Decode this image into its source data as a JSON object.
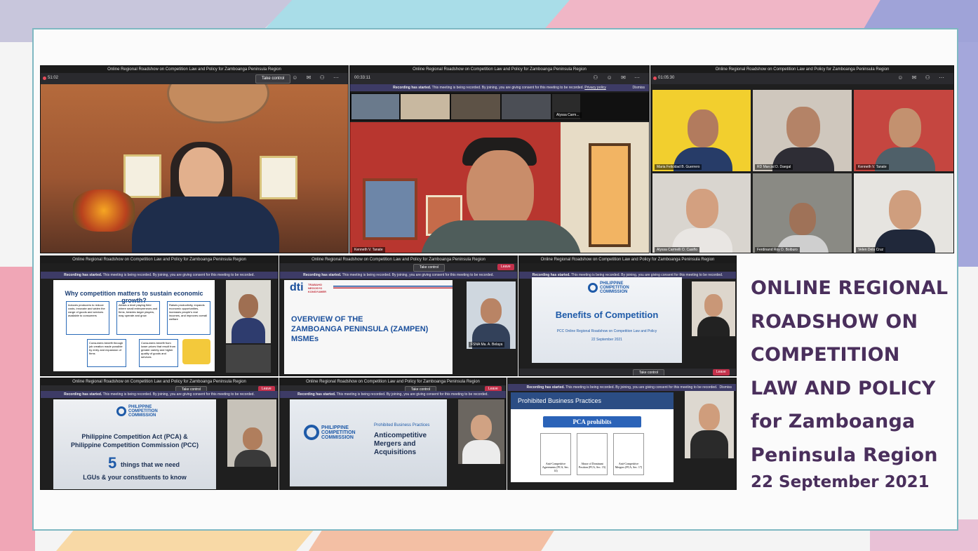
{
  "banner": {
    "title_lines": [
      "ONLINE REGIONAL",
      "ROADSHOW ON",
      "COMPETITION",
      "LAW AND POLICY",
      "for Zamboanga",
      "Peninsula Region"
    ],
    "date": "22 September 2021"
  },
  "meeting_title": "Online Regional Roadshow on Competition Law and Policy for Zamboanga Peninsula Region",
  "recording_notice": "Recording has started.",
  "recording_detail": "This meeting is being recorded. By joining, you are giving consent for this meeting to be recorded.",
  "privacy_policy": "Privacy policy",
  "dismiss": "Dismiss",
  "take_control": "Take control",
  "leave": "Leave",
  "windows": {
    "w1": {
      "timer": "51:02"
    },
    "w2": {
      "timer": "00:33:11",
      "main_name": "Kenneth V. Tanate",
      "thumb_name": "Alyssa Carm..."
    },
    "w3": {
      "timer": "01:05:30",
      "names": [
        "Maria Felicidad B. Guerrero",
        "RD Marcial D. Daegal",
        "Kenneth V. Tanate",
        "Alyssa Carmelli O. Casiño",
        "Ferdinand Roy D. Boiburo",
        "Velen Dela Cruz"
      ]
    }
  },
  "slides": {
    "s1": {
      "title": "Why competition matters to sustain economic growth?",
      "boxes": [
        "Induces producers to reduce costs, innovate and widen the range of goods and services available to consumers",
        "Allows a level playing field where small entrepreneurs and firms, besides larger players, may operate and grow",
        "Raises productivity, expands economic opportunities, increases people's real incomes, and improves overall welfare",
        "Consumers benefit through job creation made possible by entry and expansion of firms",
        "Consumers benefit from lower prices that result from greater variety and higher quality of goods and services"
      ]
    },
    "s2": {
      "brand": "dti",
      "brand_sub": "TRABAHO NEGOSYO KONSYUMER",
      "title_lines": [
        "OVERVIEW OF THE",
        "ZAMBOANGA PENINSULA (ZAMPEN)",
        "MSMEs"
      ],
      "name": "FSNA Ma. A. Belaya"
    },
    "s3": {
      "org": "PHILIPPINE COMPETITION COMMISSION",
      "title": "Benefits of Competition",
      "subtitle": "PCC Online Regional Roadshow on Competition Law and Policy",
      "date": "22 September 2021"
    },
    "s4": {
      "org": "PHILIPPINE COMPETITION COMMISSION",
      "title_lines": [
        "Philippine Competition Act (PCA) &",
        "Philippine Competition Commission (PCC)"
      ],
      "number": "5",
      "rest_1": "things that we need",
      "rest_2": "LGUs & your constituents to know"
    },
    "s5": {
      "org": "PHILIPPINE COMPETITION COMMISSION",
      "kicker": "Prohibited Business Practices",
      "title_lines": [
        "Anticompetitive",
        "Mergers and",
        "Acquisitions"
      ]
    },
    "s6": {
      "header": "Prohibited Business Practices",
      "pill": "PCA prohibits",
      "items": [
        "Anti-Competitive Agreements (PCA, Sec. 14)",
        "Abuse of Dominant Position (PCA, Sec. 15)",
        "Anti-Competitive Mergers (PCA, Sec. 17)"
      ]
    }
  },
  "colors": {
    "accent": "#4a2f5c",
    "teams_bar": "#3d3b66",
    "leave": "#c4314b"
  }
}
